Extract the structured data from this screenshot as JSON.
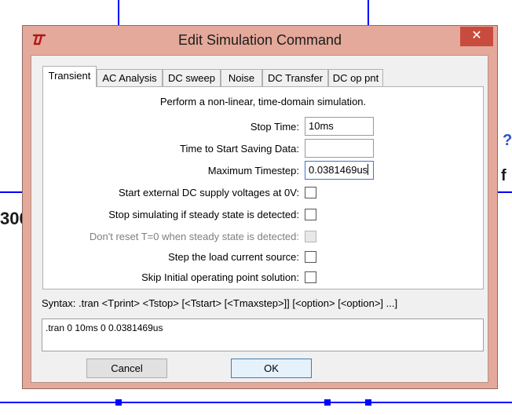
{
  "dialog": {
    "title": "Edit Simulation Command",
    "close_label": "✕"
  },
  "tabs": [
    {
      "label": "Transient",
      "active": true
    },
    {
      "label": "AC Analysis"
    },
    {
      "label": "DC sweep"
    },
    {
      "label": "Noise"
    },
    {
      "label": "DC Transfer"
    },
    {
      "label": "DC op pnt"
    }
  ],
  "transient": {
    "description": "Perform a non-linear, time-domain simulation.",
    "stop_time": {
      "label": "Stop Time:",
      "value": "10ms"
    },
    "start_saving": {
      "label": "Time to Start Saving Data:",
      "value": ""
    },
    "max_timestep": {
      "label": "Maximum Timestep:",
      "value": "0.0381469us"
    },
    "options": [
      {
        "label": "Start external DC supply voltages at 0V:",
        "checked": false,
        "enabled": true
      },
      {
        "label": "Stop simulating if steady state is detected:",
        "checked": false,
        "enabled": true
      },
      {
        "label": "Don't reset T=0 when steady state is detected:",
        "checked": false,
        "enabled": false
      },
      {
        "label": "Step the load current source:",
        "checked": false,
        "enabled": true
      },
      {
        "label": "Skip Initial operating point solution:",
        "checked": false,
        "enabled": true
      }
    ]
  },
  "syntax": "Syntax:  .tran <Tprint> <Tstop> [<Tstart> [<Tmaxstep>]] [<option> [<option>] ...]",
  "command": ".tran 0 10ms 0  0.0381469us",
  "buttons": {
    "cancel": "Cancel",
    "ok": "OK"
  },
  "background": {
    "left_text": "300",
    "right_text_1": "?",
    "right_text_2": "f"
  },
  "colors": {
    "dialog_frame": "#e4a99a",
    "close_button": "#c84c3e",
    "schematic_wire": "#0000ff"
  }
}
